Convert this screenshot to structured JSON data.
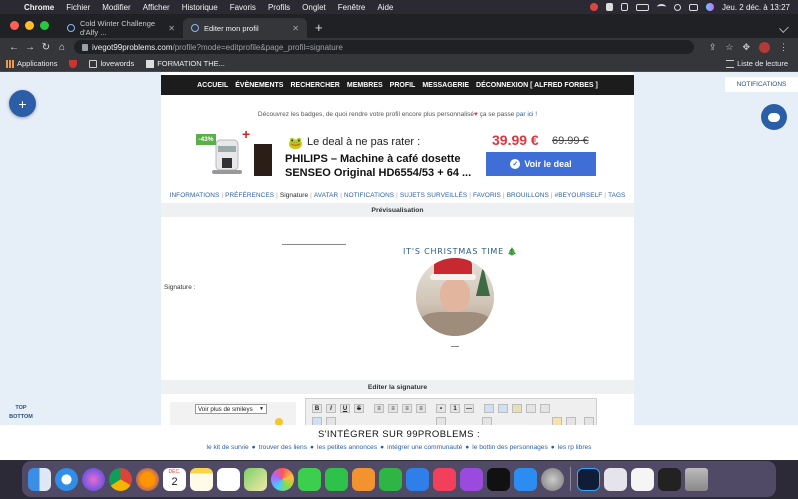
{
  "menubar": {
    "app": "Chrome",
    "items": [
      "Fichier",
      "Modifier",
      "Afficher",
      "Historique",
      "Favoris",
      "Profils",
      "Onglet",
      "Fenêtre",
      "Aide"
    ],
    "clock": "Jeu. 2 déc. à 13:27"
  },
  "tabs": [
    {
      "label": "Cold Winter Challenge d'Alfy ..."
    },
    {
      "label": "Editer mon profil"
    }
  ],
  "address": {
    "host": "ivegot99problems.com",
    "path": "/profile?mode=editprofile&page_profil=signature"
  },
  "bookmarks": {
    "items": [
      "Applications",
      "lovewords",
      "FORMATION THE..."
    ],
    "reading_list": "Liste de lecture"
  },
  "site_nav": [
    "ACCUEIL",
    "ÉVÈNEMENTS",
    "RECHERCHER",
    "MEMBRES",
    "PROFIL",
    "MESSAGERIE",
    "DÉCONNEXION [ ALFRED FORBES ]"
  ],
  "notifications_label": "NOTIFICATIONS",
  "badge_line": {
    "before": "Découvrez les badges, de quoi rendre votre profil encore plus personnalisé",
    "heart": "♥",
    "middle": " ça se passe ",
    "link": "par ici",
    "after": " !"
  },
  "ad": {
    "discount": "-43%",
    "headline": "Le deal à ne pas rater :",
    "product": "PHILIPS – Machine à café dosette SENSEO Original HD6554/53 + 64 ...",
    "price": "39.99 €",
    "old_price": "69.99 €",
    "cta": "Voir le deal"
  },
  "profile_nav": {
    "items": [
      "INFORMATIONS",
      "PRÉFÉRENCES",
      "Signature",
      "AVATAR",
      "NOTIFICATIONS",
      "SUJETS SURVEILLÉS",
      "FAVORIS",
      "BROUILLONS",
      "#BEYOURSELF",
      "TAGS"
    ],
    "current": "Signature"
  },
  "preview": {
    "header": "Prévisualisation",
    "label": "Signature :",
    "title": "IT'S CHRISTMAS TIME 🎄"
  },
  "editor": {
    "header": "Editer la signature",
    "smileys_select": "Voir plus de smileys",
    "toolbar_row1": [
      "B",
      "I",
      "U",
      "S"
    ]
  },
  "side": {
    "top": "TOP",
    "bottom": "BOTTOM"
  },
  "integrate": {
    "title": "S'INTÉGRER SUR 99PROBLEMS :",
    "links": [
      "le kit de survie",
      "trouver des liens",
      "les petites annonces",
      "intégrer une communauté",
      "le bottin des personnages",
      "les rp libres"
    ]
  },
  "colors": {
    "accent": "#2a5fa8",
    "price_red": "#e0353e",
    "discount_green": "#58b047",
    "cta_blue": "#3f6fd6"
  },
  "dock_apps": [
    "finder-icon",
    "safari-icon",
    "siri-icon",
    "chrome-icon",
    "firefox-icon",
    "calendar-icon",
    "notes-icon",
    "reminders-icon",
    "maps-icon",
    "photos-icon",
    "messages-icon",
    "facetime-icon",
    "pages-icon",
    "numbers-icon",
    "keynote-icon",
    "music-icon",
    "podcasts-icon",
    "tv-icon",
    "appstore-icon",
    "settings-icon",
    "photoshop-icon",
    "preview-icon",
    "cutter-icon",
    "screen-icon",
    "trash-icon"
  ],
  "dock_calendar": {
    "month": "DÉC.",
    "day": "2"
  }
}
